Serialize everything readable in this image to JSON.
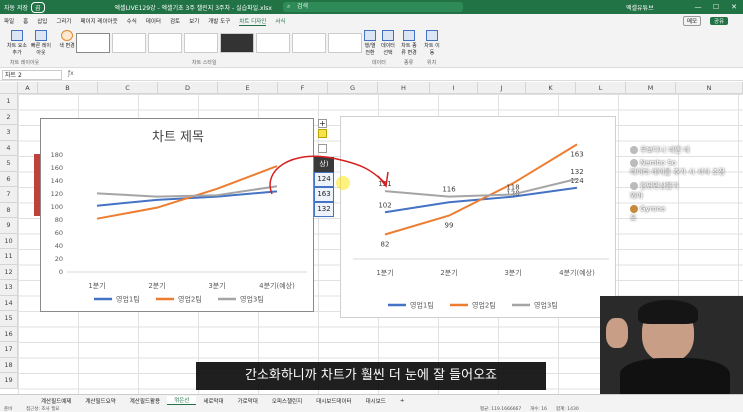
{
  "title_bar": {
    "autosave": "자동 저장",
    "toggle": "끔",
    "filename": "엑셀LIVE129강 - 엑셀기초 3주 챌린지 3주차 - 실습파일.xlsx",
    "search_placeholder": "검색",
    "user": "엑셀유튜브"
  },
  "menu": {
    "items": [
      "파일",
      "홈",
      "삽입",
      "그리기",
      "페이지 레이아웃",
      "수식",
      "데이터",
      "검토",
      "보기",
      "개발 도구",
      "차트 디자인",
      "서식"
    ],
    "active": "차트 디자인",
    "comments_label": "메모",
    "share_label": "공유"
  },
  "ribbon": {
    "buttons": [
      "차트 요소 추가",
      "빠른 레이아웃",
      "색 변경",
      "행/열 전환",
      "데이터 선택",
      "차트 종류 변경",
      "차트 이동"
    ],
    "groups": [
      "차트 레이아웃",
      "차트 스타일",
      "데이터",
      "종류",
      "위치"
    ]
  },
  "name_box": "차트 2",
  "columns": [
    "A",
    "B",
    "C",
    "D",
    "E",
    "F",
    "G",
    "H",
    "I",
    "J",
    "K",
    "L",
    "M",
    "N"
  ],
  "rows": [
    "1",
    "2",
    "3",
    "4",
    "5",
    "6",
    "7",
    "8",
    "9",
    "10",
    "11",
    "12",
    "13",
    "14",
    "15",
    "16",
    "17",
    "18",
    "19"
  ],
  "cells": {
    "f5": "상)",
    "f6": "124",
    "f7": "163",
    "f8": "132"
  },
  "chart_data": [
    {
      "type": "line",
      "title": "차트 제목",
      "categories": [
        "1분기",
        "2분기",
        "3분기",
        "4분기(예상)"
      ],
      "series": [
        {
          "name": "영업1팀",
          "values": [
            102,
            111,
            116,
            124
          ]
        },
        {
          "name": "영업2팀",
          "values": [
            82,
            99,
            128,
            163
          ]
        },
        {
          "name": "영업3팀",
          "values": [
            121,
            116,
            118,
            132
          ]
        }
      ],
      "ylim": [
        0,
        180
      ],
      "yticks": [
        "0",
        "20",
        "40",
        "60",
        "80",
        "100",
        "120",
        "140",
        "160",
        "180"
      ],
      "grid": false,
      "legend": "bottom"
    },
    {
      "type": "line",
      "title": "",
      "categories": [
        "1분기",
        "2분기",
        "3분기",
        "4분기(예상)"
      ],
      "series": [
        {
          "name": "영업1팀",
          "values": [
            102,
            111,
            116,
            124
          ]
        },
        {
          "name": "영업2팀",
          "values": [
            82,
            99,
            128,
            163
          ]
        },
        {
          "name": "영업3팀",
          "values": [
            121,
            116,
            118,
            132
          ]
        }
      ],
      "labels": [
        [
          "102",
          "",
          "",
          "124"
        ],
        [
          "82",
          "99",
          "128",
          "163"
        ],
        [
          "121",
          "116",
          "118",
          "132"
        ]
      ],
      "ylim": [
        60,
        175
      ],
      "legend": "bottom"
    }
  ],
  "series_colors": [
    "#4472c4",
    "#ed7d31",
    "#a5a5a5"
  ],
  "chat": [
    {
      "name": "쿠보다니",
      "text": "네엔 네"
    },
    {
      "name": "Nemho So",
      "text": "데이터 레이블 추가 시 서식 조정"
    },
    {
      "name": "한민민상불가 ",
      "text": "와아"
    },
    {
      "name": "Gyrone",
      "text": "오"
    }
  ],
  "subtitle": "간소화하니까 차트가 훨씬 더 눈에 잘 들어오죠",
  "sheet_tabs": [
    "계산필드예제",
    "계산필드요약",
    "계산필드활용",
    "꺾은선",
    "세로막대",
    "가로막대",
    "오피스챌린지",
    "대시보드데이터",
    "대시보드"
  ],
  "active_tab": "꺾은선",
  "status": {
    "ready": "준비",
    "accessibility": "접근성: 조사 필요",
    "average": "평균: 119.1666667",
    "count": "개수: 16",
    "sum": "합계: 1430"
  }
}
